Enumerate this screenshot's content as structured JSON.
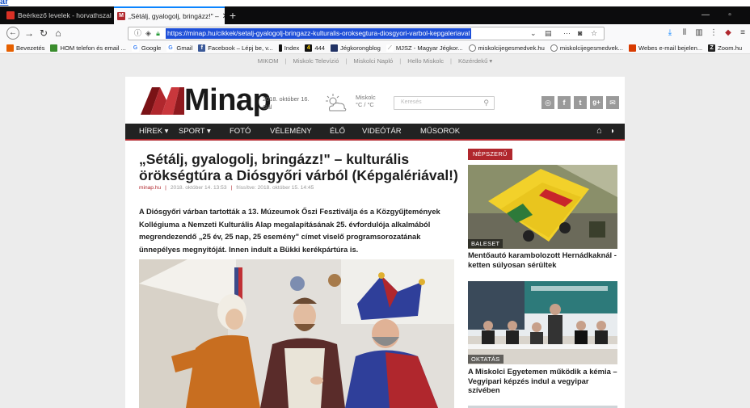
{
  "browser": {
    "top_link": "ar",
    "tabs": [
      {
        "title": "Beérkező levelek - horvathszal",
        "active": false
      },
      {
        "title": "„Sétálj, gyalogolj, bringázz!\" –",
        "active": true
      }
    ],
    "url": "https://minap.hu/cikkek/setalj-gyalogolj-bringazz-kulturalis-oroksegtura-diosgyori-varbol-kepgaleriaval",
    "bookmarks": [
      {
        "label": "Bevezetés",
        "icon": "firefox-icon",
        "color": "#e66000"
      },
      {
        "label": "HOM telefon és email ...",
        "icon": "hom-icon",
        "color": "#3b8d2e"
      },
      {
        "label": "Google",
        "icon": "google-icon",
        "color": "#4285f4",
        "glyph": "G"
      },
      {
        "label": "Gmail",
        "icon": "google-icon",
        "color": "#4285f4",
        "glyph": "G"
      },
      {
        "label": "Facebook – Lépj be, v...",
        "icon": "facebook-icon",
        "color": "#3b5998",
        "glyph": "f"
      },
      {
        "label": "Index",
        "icon": "index-icon",
        "color": "#111"
      },
      {
        "label": "444",
        "icon": "444-icon",
        "color": "#111",
        "glyph": "4"
      },
      {
        "label": "Jégkorongblog",
        "icon": "blog-icon",
        "color": "#223366"
      },
      {
        "label": "MJSZ - Magyar Jégkor...",
        "icon": "mjsz-icon",
        "color": "#666"
      },
      {
        "label": "miskolcijegesmedvek.hu",
        "icon": "globe-icon",
        "color": "#555"
      },
      {
        "label": "miskolcijegesmedvek...",
        "icon": "globe-icon",
        "color": "#555"
      },
      {
        "label": "Webes e-mail bejelen...",
        "icon": "mail-icon",
        "color": "#d83b01"
      },
      {
        "label": "Zoom.hu",
        "icon": "zoom-icon",
        "color": "#222",
        "glyph": "Z"
      }
    ]
  },
  "site": {
    "top_links": [
      "MIKOM",
      "Miskolc Televízió",
      "Miskolci Napló",
      "Hello Miskolc",
      "Közérdekű ▾"
    ],
    "logo": "Minap",
    "date": "2018. október 16.",
    "nameday": "Gál",
    "weather_city": "Miskolc",
    "weather_temp": "°C / °C",
    "search_placeholder": "Keresés",
    "social": [
      "◎",
      "f",
      "t",
      "g+",
      "✉"
    ],
    "nav": [
      "HÍREK ▾",
      "SPORT ▾",
      "FOTÓ",
      "VÉLEMÉNY",
      "ÉLŐ",
      "VIDEÓTÁR",
      "MŰSOROK"
    ]
  },
  "article": {
    "title": "„Sétálj, gyalogolj, bringázz!\" – kulturális örökségtúra a Diósgyőri várból (Képgalériával!)",
    "source": "minap.hu",
    "published": "2018. október 14. 13:53",
    "updated": "frissítve: 2018. október 15. 14:45",
    "lead": "A Diósgyőri várban tartották a 13. Múzeumok Őszi Fesztiválja és a Közgyűjtemények Kollégiuma a Nemzeti Kulturális Alap megalapításának 25. évfordulója alkalmából megrendezendő „25 év, 25 nap, 25 esemény\" címet viselő programsorozatának ünnepélyes megnyitóját. Innen indult a Bükki kerékpártúra is."
  },
  "sidebar": {
    "popular_label": "NÉPSZERŰ",
    "cards": [
      {
        "category": "BALESET",
        "title": "Mentőautó karambolozott Hernádkaknál - ketten súlyosan sérültek"
      },
      {
        "category": "OKTATÁS",
        "title": "A Miskolci Egyetemen működik a kémia – Vegyipari képzés indul a vegyipar szívében"
      }
    ]
  },
  "colors": {
    "accent": "#b0272d",
    "nav_bg": "#222222",
    "url_select": "#1e4fd8"
  }
}
